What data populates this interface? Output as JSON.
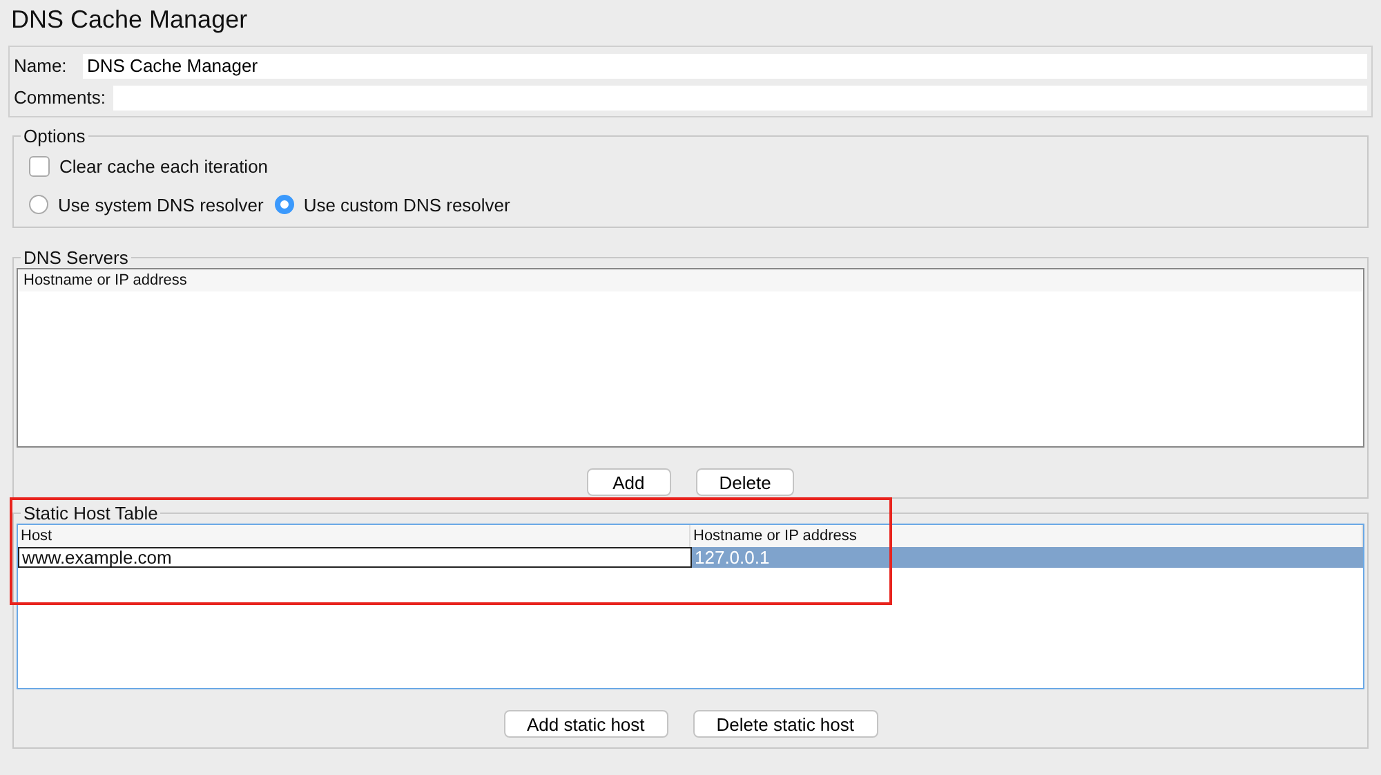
{
  "title": "DNS Cache Manager",
  "name_field": {
    "label": "Name:",
    "value": "DNS Cache Manager"
  },
  "comments_field": {
    "label": "Comments:"
  },
  "options": {
    "legend": "Options",
    "clear_cache": {
      "label": "Clear cache each iteration",
      "checked": false
    },
    "resolvers": [
      {
        "label": "Use system DNS resolver",
        "selected": false
      },
      {
        "label": "Use custom DNS resolver",
        "selected": true
      }
    ]
  },
  "dns_servers": {
    "legend": "DNS Servers",
    "columns": [
      "Hostname or IP address"
    ],
    "buttons": [
      "Add",
      "Delete"
    ]
  },
  "static_hosts": {
    "legend": "Static Host Table",
    "highlighted": true,
    "columns": [
      "Host",
      "Hostname or IP address"
    ],
    "rows": [
      {
        "host": "www.example.com",
        "address": "127.0.0.1",
        "selected": true,
        "editing": true
      }
    ],
    "buttons": [
      "Add static host",
      "Delete static host"
    ]
  }
}
